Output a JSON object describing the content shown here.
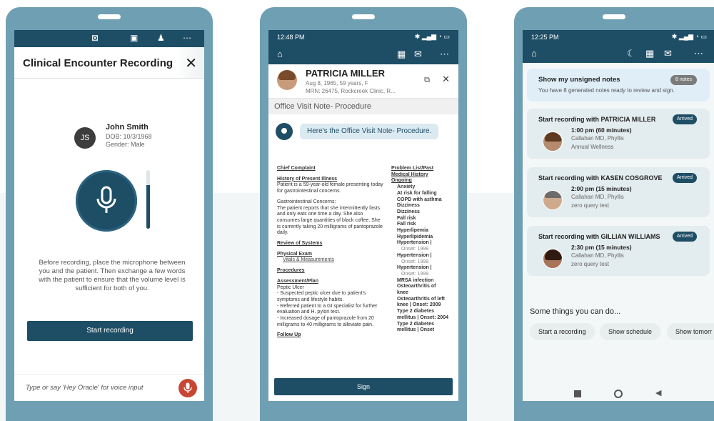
{
  "phone1": {
    "title": "Clinical Encounter Recording",
    "close": "✕",
    "patient": {
      "initials": "JS",
      "name": "John Smith",
      "dob": "DOB: 10/3/1968",
      "gender": "Gender: Male"
    },
    "volume_level": 0.75,
    "instructions": "Before recording, place the microphone between you and the patient. Then exchange a few words with the patient to ensure that the volume level is sufficient for both of you.",
    "start_button": "Start recording",
    "input_placeholder": "Type or say 'Hey Oracle' for voice input"
  },
  "phone2": {
    "status_time": "12:48 PM",
    "patient_name": "PATRICIA MILLER",
    "patient_sub1": "Aug 8, 1965, 59 years, F",
    "patient_sub2": "MRN: 26475, Rockcreek Clinic, R...",
    "note_title": "Office Visit Note- Procedure",
    "bubble": "Here's the Office Visit Note- Procedure.",
    "left_col": [
      {
        "t": "h",
        "v": "Chief Complaint"
      },
      {
        "t": "gap"
      },
      {
        "t": "h",
        "v": "History of Present Illness"
      },
      {
        "t": "p",
        "v": "Patient is a 59-year-old female presenting today for gastrointestinal concerns."
      },
      {
        "t": "gap"
      },
      {
        "t": "p",
        "v": "Gastrointestinal Concerns:"
      },
      {
        "t": "p",
        "v": "The patient reports that she intermittently fasts and only eats one time a day. She also consumes large quantities of black coffee. She is currently taking 20 milligrams of pantoprazole daily."
      },
      {
        "t": "gap"
      },
      {
        "t": "h",
        "v": "Review of Systems"
      },
      {
        "t": "gap"
      },
      {
        "t": "h",
        "v": "Physical Exam"
      },
      {
        "t": "lk",
        "v": "Vitals & Measurements"
      },
      {
        "t": "gap"
      },
      {
        "t": "h",
        "v": "Procedures"
      },
      {
        "t": "gap"
      },
      {
        "t": "h",
        "v": "Assessment/Plan"
      },
      {
        "t": "p",
        "v": "Peptic Ulcer"
      },
      {
        "t": "p",
        "v": "- Suspected peptic ulcer due to patient's symptoms and lifestyle habits."
      },
      {
        "t": "p",
        "v": "- Referred patient to a GI specialist for further evaluation and H. pylori test."
      },
      {
        "t": "p",
        "v": "- Increased dosage of pantoprazole from 20 milligrams to 40 milligrams to alleviate pain."
      },
      {
        "t": "gap"
      },
      {
        "t": "h",
        "v": "Follow Up"
      }
    ],
    "right_col": [
      {
        "t": "h",
        "v": "Problem List/Past Medical History"
      },
      {
        "t": "h",
        "v": "Ongoing"
      },
      {
        "t": "pb",
        "v": "Anxiety"
      },
      {
        "t": "pb",
        "v": "At risk for falling"
      },
      {
        "t": "pb",
        "v": "COPD with asthma"
      },
      {
        "t": "pb",
        "v": "Dizziness"
      },
      {
        "t": "pb",
        "v": "Dizziness"
      },
      {
        "t": "pb",
        "v": "Fall risk"
      },
      {
        "t": "pb",
        "v": "Fall risk"
      },
      {
        "t": "pb",
        "v": "Hyperlipemia"
      },
      {
        "t": "pb",
        "v": "Hyperlipidemia"
      },
      {
        "t": "pb",
        "v": "Hypertension |"
      },
      {
        "t": "on",
        "v": "Onset: 1999"
      },
      {
        "t": "pb",
        "v": "Hypertension |"
      },
      {
        "t": "on",
        "v": "Onset: 1999"
      },
      {
        "t": "pb",
        "v": "Hypertension |"
      },
      {
        "t": "on",
        "v": "Onset: 1999"
      },
      {
        "t": "pb",
        "v": "MRSA infection"
      },
      {
        "t": "pb",
        "v": "Osteoarthritis of knee"
      },
      {
        "t": "pb",
        "v": "Osteoarthritis of left knee | Onset: 2009"
      },
      {
        "t": "pb",
        "v": "Type 2 diabetes mellitus | Onset: 2004"
      },
      {
        "t": "pb",
        "v": "Type 2 diabetes mellitus | Onset"
      }
    ],
    "sign_button": "Sign"
  },
  "phone3": {
    "status_time": "12:25 PM",
    "unsigned": {
      "title": "Show my unsigned notes",
      "badge": "8 notes",
      "sub": "You have 8 generated notes ready to review and sign."
    },
    "appointments": [
      {
        "title": "Start recording with PATRICIA MILLER",
        "badge": "Arrived",
        "time": "1:00 pm (60 minutes)",
        "provider": "Callahan MD, Phyllis",
        "type": "Annual Wellness"
      },
      {
        "title": "Start recording with KASEN COSGROVE",
        "badge": "Arrived",
        "time": "2:00 pm (15 minutes)",
        "provider": "Callahan MD, Phyllis",
        "type": "zero query test"
      },
      {
        "title": "Start recording with GILLIAN WILLIAMS",
        "badge": "Arrived",
        "time": "2:30 pm (15 minutes)",
        "provider": "Callahan MD, Phyllis",
        "type": "zero query test"
      }
    ],
    "things_title": "Some things you can do...",
    "chips": [
      "Start a recording",
      "Show schedule",
      "Show tomorr"
    ]
  },
  "colors": {
    "primary": "#1e4e66",
    "frame": "#6f9fb3",
    "mic_red": "#c74634"
  }
}
